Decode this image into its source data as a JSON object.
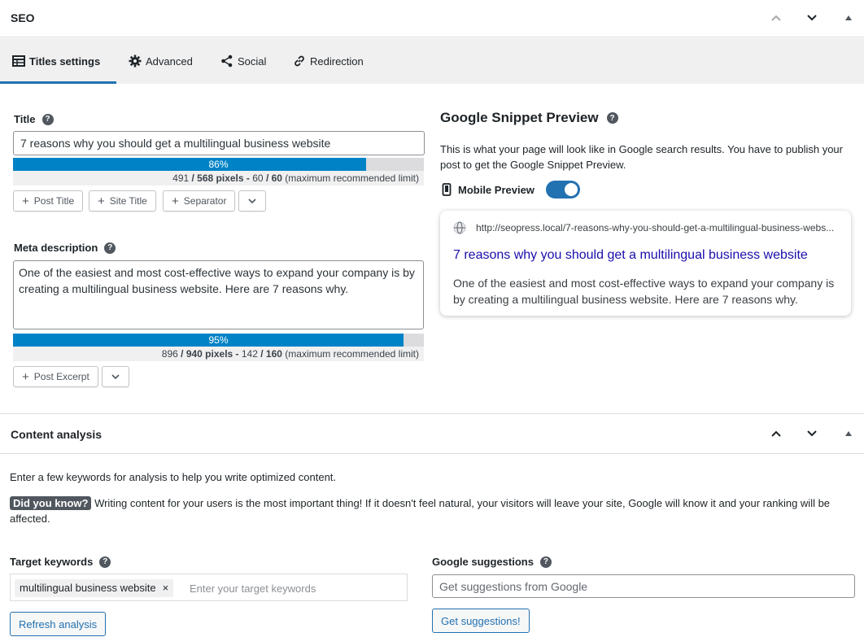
{
  "seo_panel": {
    "title": "SEO",
    "tabs": [
      {
        "label": "Titles settings",
        "icon": "table-icon"
      },
      {
        "label": "Advanced",
        "icon": "gear-icon"
      },
      {
        "label": "Social",
        "icon": "share-icon"
      },
      {
        "label": "Redirection",
        "icon": "link-icon"
      }
    ]
  },
  "title_field": {
    "label": "Title",
    "help": "?",
    "value": "7 reasons why you should get a multilingual business website",
    "progress_pct": 86,
    "progress_label": "86%",
    "pixels_used": "491",
    "pixels_max": "/ 568 pixels -",
    "chars_used": "60",
    "chars_max": "/ 60",
    "limit_note": "(maximum recommended limit)",
    "buttons": [
      "Post Title",
      "Site Title",
      "Separator"
    ]
  },
  "meta_field": {
    "label": "Meta description",
    "help": "?",
    "value": "One of the easiest and most cost-effective ways to expand your company is by creating a multilingual business website. Here are 7 reasons why.",
    "progress_pct": 95,
    "progress_label": "95%",
    "pixels_used": "896",
    "pixels_max": "/ 940 pixels -",
    "chars_used": "142",
    "chars_max": "/ 160",
    "limit_note": "(maximum recommended limit)",
    "buttons": [
      "Post Excerpt"
    ]
  },
  "snippet": {
    "heading": "Google Snippet Preview",
    "help": "?",
    "description": "This is what your page will look like in Google search results. You have to publish your post to get the Google Snippet Preview.",
    "mobile_label": "Mobile Preview",
    "mobile_enabled": true,
    "url": "http://seopress.local/7-reasons-why-you-should-get-a-multilingual-business-webs...",
    "result_title": "7 reasons why you should get a multilingual business website",
    "result_desc": "One of the easiest and most cost-effective ways to expand your company is by creating a multilingual business website. Here are 7 reasons why."
  },
  "content_analysis": {
    "title": "Content analysis",
    "intro": "Enter a few keywords for analysis to help you write optimized content.",
    "tip_badge": "Did you know?",
    "tip_text": " Writing content for your users is the most important thing! If it doesn't feel natural, your visitors will leave your site, Google will know it and your ranking will be affected.",
    "keywords_label": "Target keywords",
    "keyword_tag": "multilingual business website",
    "keyword_remove": "×",
    "keywords_placeholder": "Enter your target keywords",
    "refresh_label": "Refresh analysis",
    "suggestions_label": "Google suggestions",
    "suggestions_placeholder": "Get suggestions from Google",
    "suggestions_button": "Get suggestions!"
  },
  "colors": {
    "accent": "#2271b1",
    "progress": "#0083c6",
    "serp_title": "#1a0dab"
  }
}
